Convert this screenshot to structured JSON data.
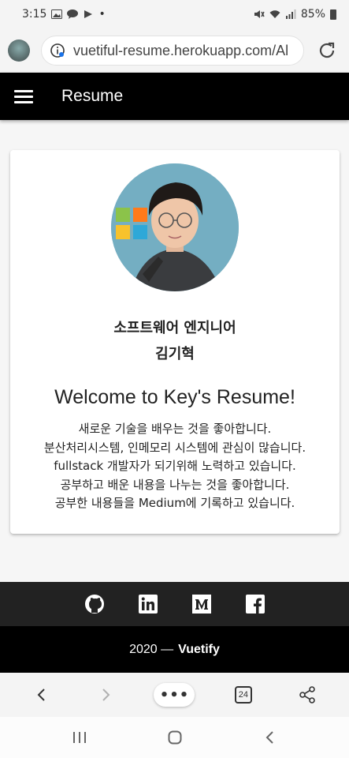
{
  "status_bar": {
    "time": "3:15",
    "dot": "•",
    "battery": "85%",
    "left_icons": [
      "image-icon",
      "talk-icon",
      "play-icon"
    ],
    "right_icons": [
      "mute-icon",
      "wifi-icon",
      "signal-icon",
      "battery-icon"
    ]
  },
  "browser": {
    "url": "vuetiful-resume.herokuapp.com/Al",
    "tab_count": "24",
    "menu_label": "•••"
  },
  "app_bar": {
    "title": "Resume"
  },
  "profile": {
    "role": "소프트웨어 엔지니어",
    "name": "김기혁",
    "welcome": "Welcome to Key's Resume!",
    "lines": [
      "새로운 기술을 배우는 것을 좋아합니다.",
      "분산처리시스템, 인메모리 시스템에 관심이 많습니다.",
      "fullstack 개발자가 되기위해 노력하고 있습니다.",
      "공부하고 배운 내용을 나누는 것을 좋아합니다.",
      "공부한 내용들을 Medium에 기록하고 있습니다."
    ]
  },
  "footer": {
    "social_icons": [
      "github-icon",
      "linkedin-icon",
      "medium-icon",
      "facebook-icon"
    ],
    "year": "2020 —",
    "brand": "Vuetify"
  },
  "colors": {
    "app_bar": "#000000",
    "social_bar": "#222222",
    "page_bg": "#f6f6f6"
  }
}
